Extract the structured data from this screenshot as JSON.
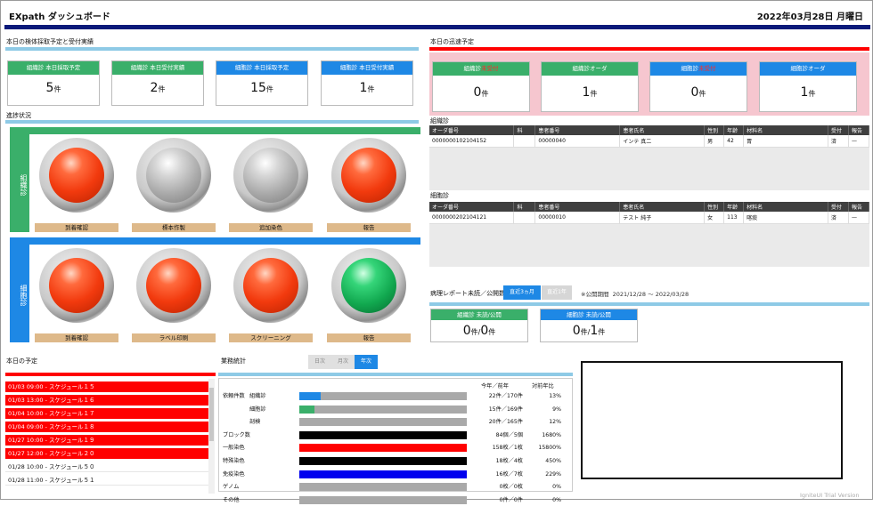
{
  "app": {
    "title": "EXpath ダッシュボード",
    "date": "2022年03月28日 月曜日",
    "watermark": "IgniteUI Trial Version"
  },
  "colors": {
    "green": "#3aaf6a",
    "blue": "#1e88e5",
    "red": "#ff0000",
    "navy": "#0a1a7a",
    "lightblue": "#8ecae6",
    "pink": "#f6c6cf",
    "tan": "#deb98a"
  },
  "left_section": {
    "title": "本日の検体採取予定と受付実績",
    "kpis": [
      {
        "label": "組織診 本日採取予定",
        "value": "5",
        "unit": "件",
        "color": "#3aaf6a"
      },
      {
        "label": "組織診 本日受付実績",
        "value": "2",
        "unit": "件",
        "color": "#3aaf6a"
      },
      {
        "label": "細胞診 本日採取予定",
        "value": "15",
        "unit": "件",
        "color": "#1e88e5"
      },
      {
        "label": "細胞診 本日受付実績",
        "value": "1",
        "unit": "件",
        "color": "#1e88e5"
      }
    ]
  },
  "progress": {
    "title": "進捗状況",
    "rows": [
      {
        "name": "組織診",
        "color": "#3aaf6a",
        "lamps": [
          {
            "state": "red",
            "label": "到着確認"
          },
          {
            "state": "gray",
            "label": "標本作製"
          },
          {
            "state": "gray",
            "label": "追加染色"
          },
          {
            "state": "red",
            "label": "報告"
          }
        ]
      },
      {
        "name": "細胞診",
        "color": "#1e88e5",
        "lamps": [
          {
            "state": "red",
            "label": "到着確認"
          },
          {
            "state": "red",
            "label": "ラベル印刷"
          },
          {
            "state": "red",
            "label": "スクリーニング"
          },
          {
            "state": "green",
            "label": "報告"
          }
        ]
      }
    ]
  },
  "urgent": {
    "title": "本日の迅速予定",
    "cards": [
      {
        "label_a": "組織診",
        "label_b": "未受付",
        "value": "0",
        "unit": "件",
        "color": "#3aaf6a"
      },
      {
        "label_a": "組織診オーダ",
        "label_b": "",
        "value": "1",
        "unit": "件",
        "color": "#3aaf6a"
      },
      {
        "label_a": "細胞診",
        "label_b": "未受付",
        "value": "0",
        "unit": "件",
        "color": "#1e88e5"
      },
      {
        "label_a": "細胞診オーダ",
        "label_b": "",
        "value": "1",
        "unit": "件",
        "color": "#1e88e5"
      }
    ],
    "columns": [
      "オーダ番号",
      "科",
      "患者番号",
      "患者氏名",
      "性別",
      "年齢",
      "材料名",
      "受付",
      "報告"
    ],
    "tissue": {
      "title": "組織診",
      "rows": [
        [
          "0000000102104152",
          "",
          "00000040",
          "インテ 真二",
          "男",
          "42",
          "胃",
          "済",
          "—"
        ]
      ]
    },
    "cyto": {
      "title": "細胞診",
      "rows": [
        [
          "0000000202104121",
          "",
          "00000010",
          "テスト 純子",
          "女",
          "113",
          "喀痰",
          "済",
          "—"
        ]
      ]
    }
  },
  "report": {
    "title": "病理レポート未読／公開数",
    "tab_active": "直近3ヵ月",
    "tab_inactive": "直近1年",
    "period_label": "※公開期間",
    "period": "2021/12/28 ～ 2022/03/28",
    "cards": [
      {
        "label": "組織診 未読/公開",
        "v1": "0",
        "u1": "件/",
        "v2": "0",
        "u2": "件",
        "color": "#3aaf6a"
      },
      {
        "label": "細胞診 未読/公開",
        "v1": "0",
        "u1": "件/",
        "v2": "1",
        "u2": "件",
        "color": "#1e88e5"
      }
    ]
  },
  "schedule": {
    "title": "本日の予定",
    "items": [
      {
        "text": "01/03 09:00 - スケジュール１５",
        "hl": true
      },
      {
        "text": "01/03 13:00 - スケジュール１６",
        "hl": true
      },
      {
        "text": "01/04 10:00 - スケジュール１７",
        "hl": true
      },
      {
        "text": "01/04 09:00 - スケジュール１８",
        "hl": true
      },
      {
        "text": "01/27 10:00 - スケジュール１９",
        "hl": true
      },
      {
        "text": "01/27 12:00 - スケジュール２０",
        "hl": true
      },
      {
        "text": "01/28 10:00 - スケジュール５０",
        "hl": false
      },
      {
        "text": "01/28 11:00 - スケジュール５１",
        "hl": false
      }
    ]
  },
  "stats": {
    "title": "業務統計",
    "tabs": [
      "日次",
      "月次",
      "年次"
    ],
    "active_tab": "年次",
    "header_cmp": "今年／前年",
    "header_ratio": "対前年比",
    "rows": [
      {
        "group": "依頼件数",
        "name": "組織診",
        "fill": 0.13,
        "color": "#1e88e5",
        "cmp": "22件／170件",
        "ratio": "13%"
      },
      {
        "group": "",
        "name": "細胞診",
        "fill": 0.09,
        "color": "#3aaf6a",
        "cmp": "15件／169件",
        "ratio": "9%"
      },
      {
        "group": "",
        "name": "剖検",
        "fill": 0.12,
        "color": "#a9a9a9",
        "cmp": "20件／165件",
        "ratio": "12%"
      },
      {
        "group": "ブロック数",
        "name": "",
        "fill": 1,
        "color": "#000000",
        "cmp": "84個／5個",
        "ratio": "1680%"
      },
      {
        "group": "一般染色",
        "name": "",
        "fill": 1,
        "color": "#ff0000",
        "cmp": "158枚／1枚",
        "ratio": "15800%"
      },
      {
        "group": "特殊染色",
        "name": "",
        "fill": 1,
        "color": "#000000",
        "cmp": "18枚／4枚",
        "ratio": "450%"
      },
      {
        "group": "免疫染色",
        "name": "",
        "fill": 1,
        "color": "#0000ee",
        "cmp": "16枚／7枚",
        "ratio": "229%"
      },
      {
        "group": "ゲノム",
        "name": "",
        "fill": 0,
        "color": "#a9a9a9",
        "cmp": "0枚／0枚",
        "ratio": "0%"
      },
      {
        "group": "その他",
        "name": "",
        "fill": 0,
        "color": "#a9a9a9",
        "cmp": "0件／0件",
        "ratio": "0%"
      }
    ]
  }
}
